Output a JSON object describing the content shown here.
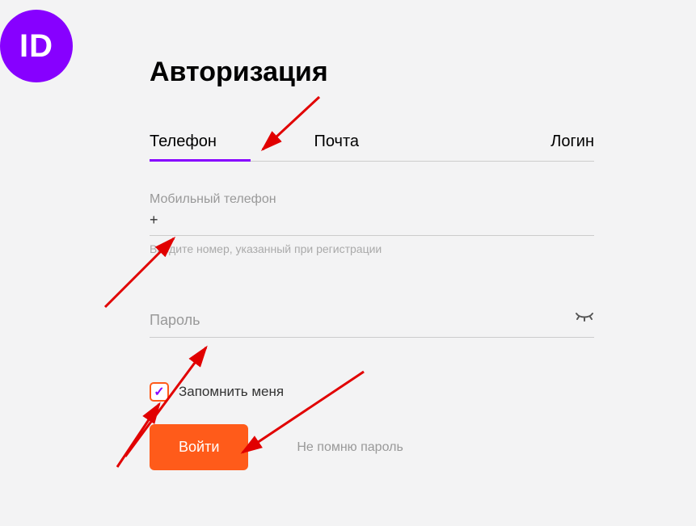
{
  "logo": "ID",
  "title": "Авторизация",
  "tabs": {
    "phone": "Телефон",
    "email": "Почта",
    "login": "Логин"
  },
  "phone_field": {
    "label": "Мобильный телефон",
    "value": "+",
    "hint": "Введите номер, указанный при регистрации"
  },
  "password_field": {
    "placeholder": "Пароль"
  },
  "remember": {
    "label": "Запомнить меня",
    "checked": true
  },
  "actions": {
    "login": "Войти",
    "forgot": "Не помню пароль"
  }
}
